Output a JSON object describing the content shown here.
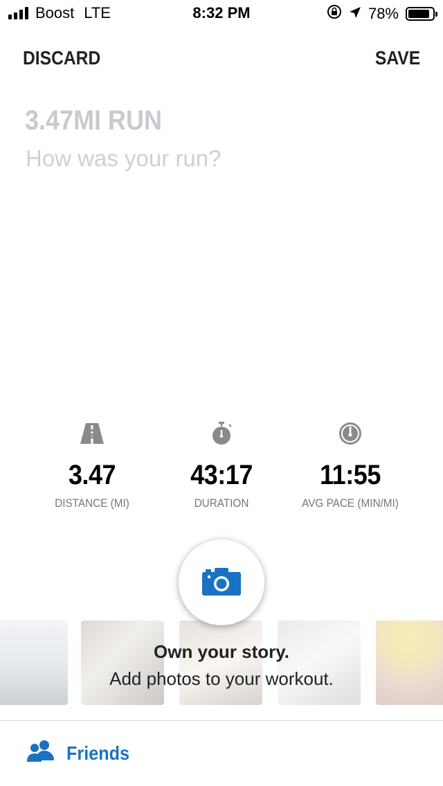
{
  "status_bar": {
    "carrier": "Boost",
    "network": "LTE",
    "time": "8:32 PM",
    "battery_percent": "78%",
    "battery_level": 0.78,
    "icons": [
      "signal-icon",
      "orientation-lock-icon",
      "location-arrow-icon",
      "battery-icon"
    ]
  },
  "toolbar": {
    "discard_label": "DISCARD",
    "save_label": "SAVE"
  },
  "workout": {
    "title_placeholder": "3.47MI RUN",
    "description_placeholder": "How was your run?"
  },
  "stats": [
    {
      "icon": "road-icon",
      "value": "3.47",
      "label": "DISTANCE (MI)"
    },
    {
      "icon": "stopwatch-icon",
      "value": "43:17",
      "label": "DURATION"
    },
    {
      "icon": "speedometer-icon",
      "value": "11:55",
      "label": "AVG PACE (MIN/MI)"
    }
  ],
  "photos": {
    "camera_icon": "camera-icon",
    "promo_title": "Own your story.",
    "promo_subtitle": "Add photos to your workout."
  },
  "footer": {
    "friends_label": "Friends",
    "friends_icon": "friends-icon"
  },
  "colors": {
    "accent": "#1a73c2",
    "placeholder": "#c9c9cf",
    "text": "#222222",
    "muted": "#777777"
  }
}
